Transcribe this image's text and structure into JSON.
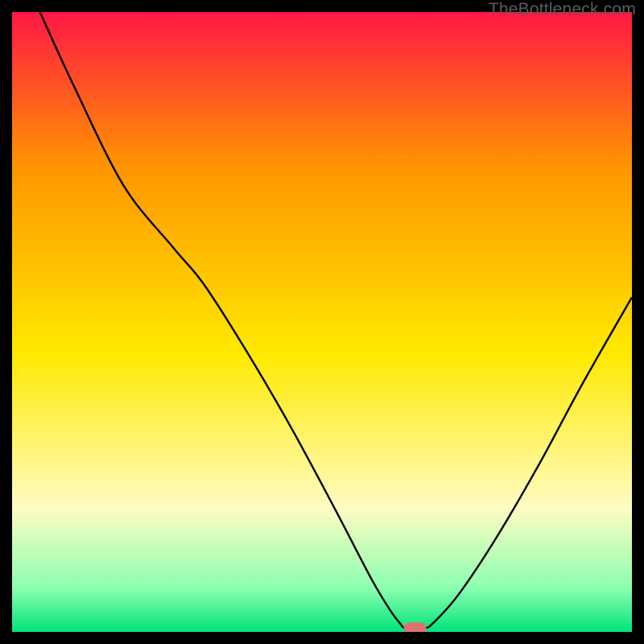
{
  "watermark": "TheBottleneck.com",
  "colors": {
    "red": "#ff1744",
    "orange": "#ff9500",
    "yellow": "#ffe900",
    "pale_yellow": "#fffcc2",
    "light_green": "#8bffb0",
    "green": "#00e37a",
    "line": "#000000",
    "marker": "#e07070"
  },
  "chart_data": {
    "type": "line",
    "title": "",
    "xlabel": "",
    "ylabel": "",
    "xlim": [
      0,
      100
    ],
    "ylim": [
      0,
      100
    ],
    "curve": [
      {
        "x": 4.5,
        "y": 100
      },
      {
        "x": 10,
        "y": 88
      },
      {
        "x": 18,
        "y": 72
      },
      {
        "x": 26,
        "y": 62
      },
      {
        "x": 31,
        "y": 56
      },
      {
        "x": 38,
        "y": 45
      },
      {
        "x": 45,
        "y": 33
      },
      {
        "x": 52,
        "y": 20
      },
      {
        "x": 58,
        "y": 8.5
      },
      {
        "x": 61,
        "y": 3.5
      },
      {
        "x": 62.5,
        "y": 1.5
      },
      {
        "x": 63.5,
        "y": 0.6
      },
      {
        "x": 66.5,
        "y": 0.6
      },
      {
        "x": 68,
        "y": 1.5
      },
      {
        "x": 72,
        "y": 6
      },
      {
        "x": 78,
        "y": 15
      },
      {
        "x": 85,
        "y": 27
      },
      {
        "x": 92,
        "y": 40
      },
      {
        "x": 100,
        "y": 54
      }
    ],
    "optimum_marker": {
      "x": 65,
      "y": 0.6
    },
    "gradient_stops": [
      {
        "offset": 0,
        "color_key": "red"
      },
      {
        "offset": 0.25,
        "color_key": "orange"
      },
      {
        "offset": 0.55,
        "color_key": "yellow"
      },
      {
        "offset": 0.8,
        "color_key": "pale_yellow"
      },
      {
        "offset": 0.93,
        "color_key": "light_green"
      },
      {
        "offset": 1.0,
        "color_key": "green"
      }
    ]
  }
}
